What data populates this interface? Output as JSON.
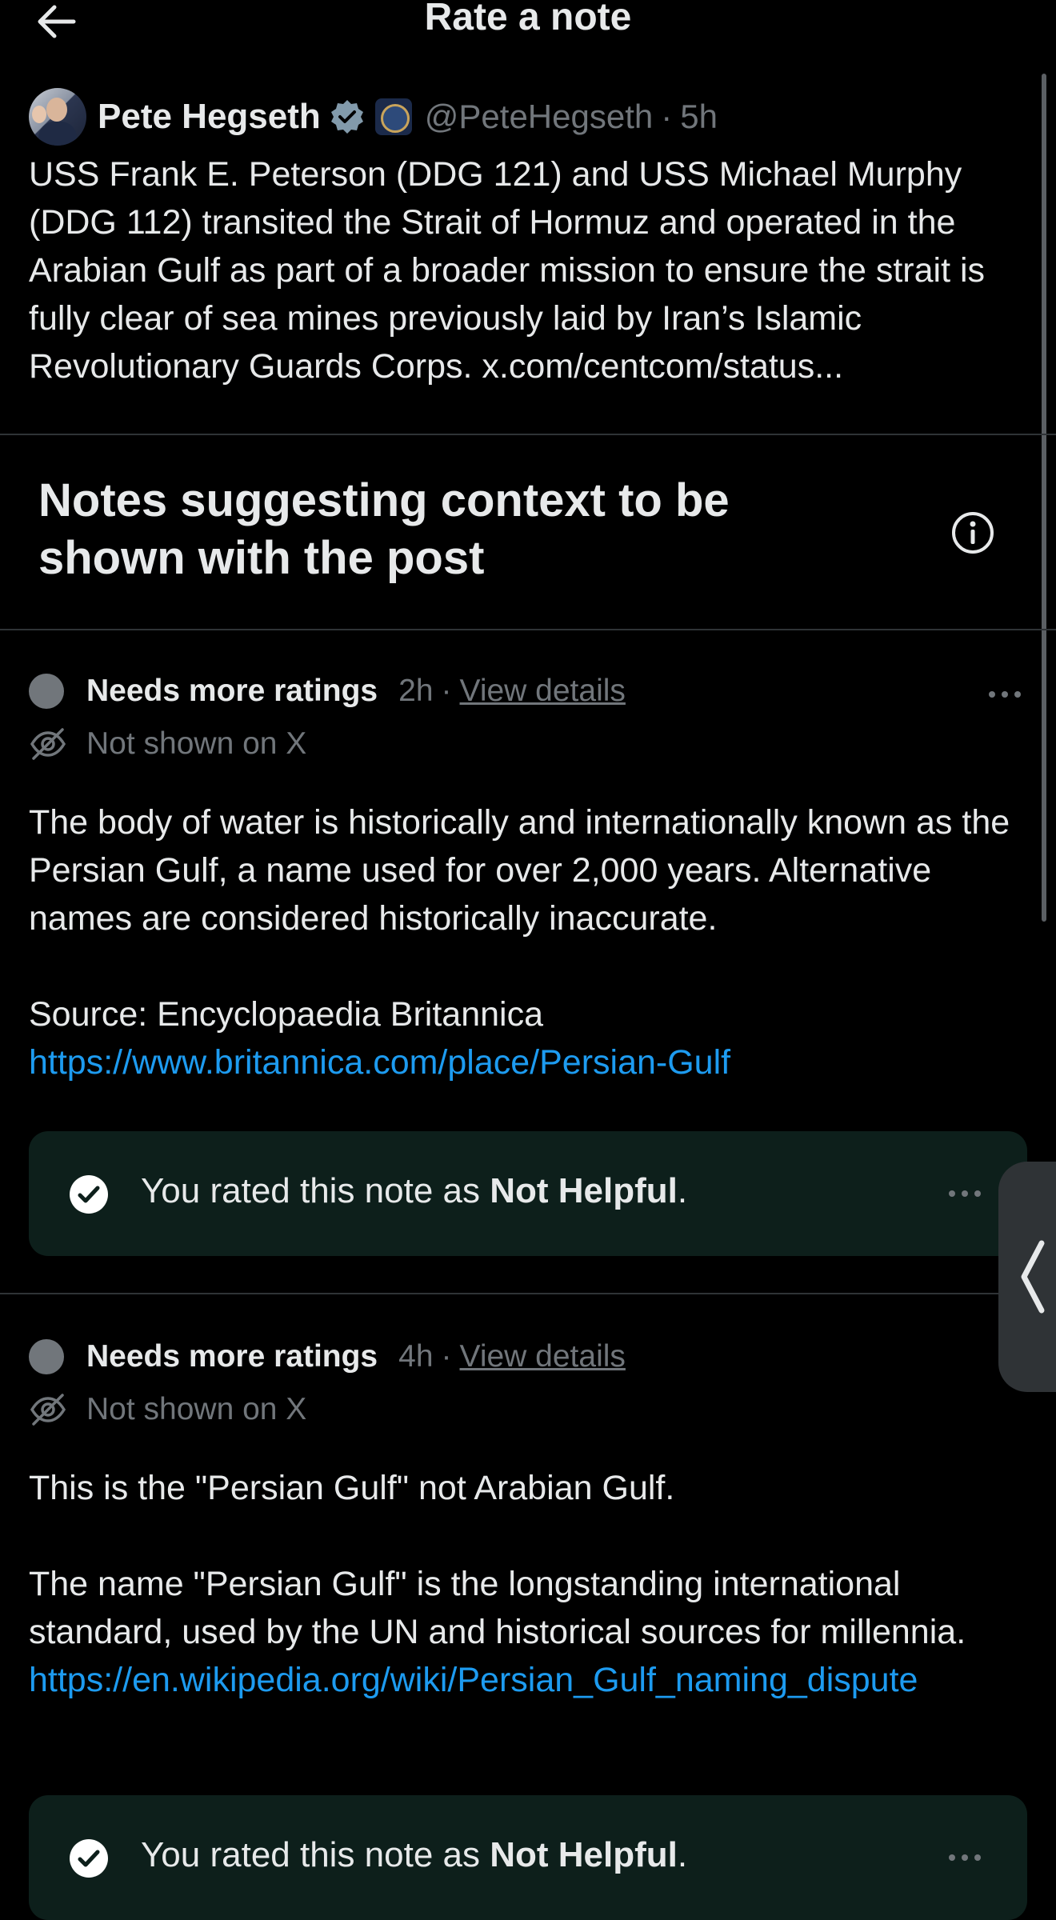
{
  "header": {
    "title": "Rate a note",
    "back_icon": "arrow-left-icon"
  },
  "post": {
    "author_name": "Pete Hegseth",
    "handle": "@PeteHegseth",
    "separator": "·",
    "time": "5h",
    "text": "USS Frank E. Peterson (DDG 121) and USS Michael Murphy (DDG 112) transited the Strait of Hormuz and operated in the Arabian Gulf as part of a broader mission to ensure the strait is fully clear of sea mines previously laid by Iran’s Islamic Revolutionary Guards Corps. x.com/centcom/status..."
  },
  "section": {
    "title": "Notes suggesting context to be shown with the post",
    "info_icon": "info-icon"
  },
  "notes": [
    {
      "status": "Needs more ratings",
      "time": "2h",
      "separator": "·",
      "view_details": "View details",
      "shown": "Not shown on X",
      "paragraph1": "The body of water is historically and internationally known as the Persian Gulf, a name used for over 2,000 years. Alternative names are considered historically inaccurate.",
      "paragraph2": "Source: Encyclopaedia Britannica",
      "link": "https://www.britannica.com/place/Persian-Gulf",
      "rated_prefix": "You rated this note as ",
      "rated_value": "Not Helpful",
      "rated_suffix": "."
    },
    {
      "status": "Needs more ratings",
      "time": "4h",
      "separator": "·",
      "view_details": "View details",
      "shown": "Not shown on X",
      "paragraph1": "This is the \"Persian Gulf\" not Arabian Gulf.",
      "paragraph2": "The name \"Persian Gulf\" is the longstanding international standard, used by the UN and historical sources for millennia.",
      "link": "https://en.wikipedia.org/wiki/Persian_Gulf_naming_dispute",
      "rated_prefix": "You rated this note as ",
      "rated_value": "Not Helpful",
      "rated_suffix": "."
    }
  ],
  "colors": {
    "background": "#000000",
    "text": "#e7e9ea",
    "muted": "#71767b",
    "link": "#1d9bf0",
    "rated_bg": "#0d1f1b",
    "verified": "#829aab"
  }
}
